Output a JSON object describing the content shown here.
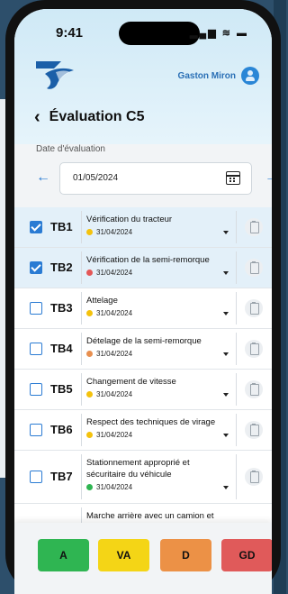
{
  "colors": {
    "accent": "#2a7bd3",
    "yellow": "#f4c20d",
    "red": "#e45757",
    "orange": "#e88f4f",
    "green": "#2fb552"
  },
  "status_bar": {
    "time": "9:41",
    "icons": "▂▄▆ ≋ ▬"
  },
  "header": {
    "user_name": "Gaston Miron",
    "title": "Évaluation C5",
    "back_icon": "chevron-left-icon"
  },
  "date": {
    "label": "Date d'évaluation",
    "value": "01/05/2024",
    "prev": "←",
    "next": "→"
  },
  "items": [
    {
      "code": "TB1",
      "label": "Vérification du tracteur",
      "date": "31/04/2024",
      "status": "yellow",
      "checked": true
    },
    {
      "code": "TB2",
      "label": "Vérification de la semi-remorque",
      "date": "31/04/2024",
      "status": "red",
      "checked": true
    },
    {
      "code": "TB3",
      "label": "Attelage",
      "date": "31/04/2024",
      "status": "yellow",
      "checked": false
    },
    {
      "code": "TB4",
      "label": "Dételage de la semi-remorque",
      "date": "31/04/2024",
      "status": "orange",
      "checked": false
    },
    {
      "code": "TB5",
      "label": "Changement de vitesse",
      "date": "31/04/2024",
      "status": "yellow",
      "checked": false
    },
    {
      "code": "TB6",
      "label": "Respect des techniques de virage",
      "date": "31/04/2024",
      "status": "yellow",
      "checked": false
    },
    {
      "code": "TB7",
      "label": "Stationnement approprié et sécuritaire du véhicule",
      "date": "31/04/2024",
      "status": "green",
      "checked": false
    },
    {
      "code": "",
      "label": "Marche arrière avec un camion et",
      "date": "",
      "status": "",
      "checked": false
    }
  ],
  "buttons": [
    {
      "label": "A",
      "color": "#2fb552"
    },
    {
      "label": "VA",
      "color": "#f4d516"
    },
    {
      "label": "D",
      "color": "#ec9146"
    },
    {
      "label": "GD",
      "color": "#e05a5a"
    }
  ]
}
